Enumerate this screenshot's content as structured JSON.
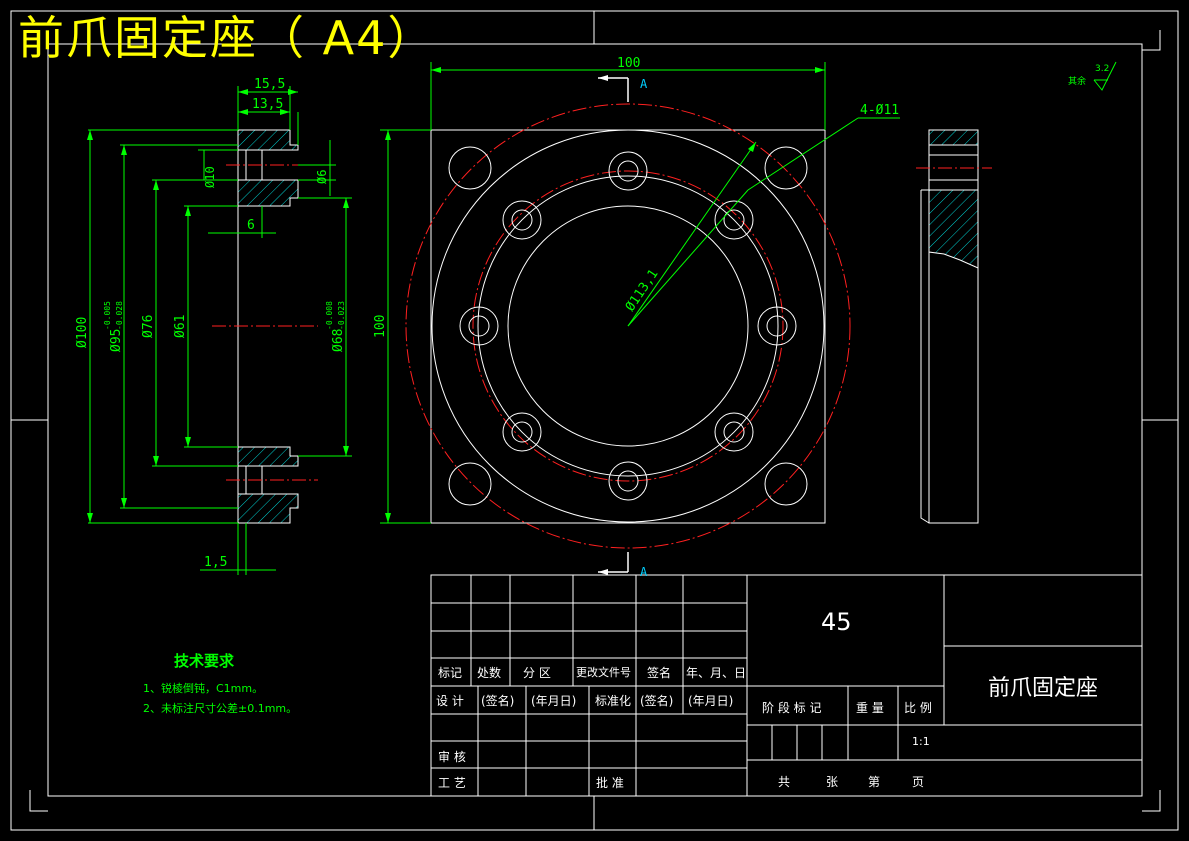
{
  "title_banner": "前爪固定座（ A4）",
  "roughness": {
    "label": "其余",
    "value": "3.2"
  },
  "dimensions": {
    "width_100": "100",
    "height_100": "100",
    "d15_5": "15,5",
    "d13_5": "13,5",
    "phi10": "Ø10",
    "phi6": "Ø6",
    "d6": "6",
    "phi100": "Ø100",
    "phi95": "Ø95",
    "phi95_tol_upper": "-0.005",
    "phi95_tol_lower": "-0.028",
    "phi76": "Ø76",
    "phi61": "Ø61",
    "phi68": "Ø68",
    "phi68_tol_upper": "-0.008",
    "phi68_tol_lower": "-0.023",
    "d1_5": "1,5",
    "holes": "4-Ø11",
    "phi113": "Ø113,1"
  },
  "section_mark": "A",
  "tech_requirements": {
    "heading": "技术要求",
    "item1": "1、锐棱倒钝，C1mm。",
    "item2": "2、未标注尺寸公差±0.1mm。"
  },
  "title_block": {
    "material": "45",
    "part_name": "前爪固定座",
    "header_row": [
      "标记",
      "处数",
      "分 区",
      "更改文件号",
      "签名",
      "年、月、日"
    ],
    "design_row": [
      "设 计",
      "(签名)",
      "(年月日)",
      "标准化",
      "(签名)",
      "(年月日)"
    ],
    "review": "审 核",
    "process": "工 艺",
    "approve": "批 准",
    "stage_headers": [
      "阶 段 标 记",
      "重 量",
      "比 例"
    ],
    "scale": "1:1",
    "sheet": [
      "共",
      "张",
      "第",
      "页"
    ]
  }
}
